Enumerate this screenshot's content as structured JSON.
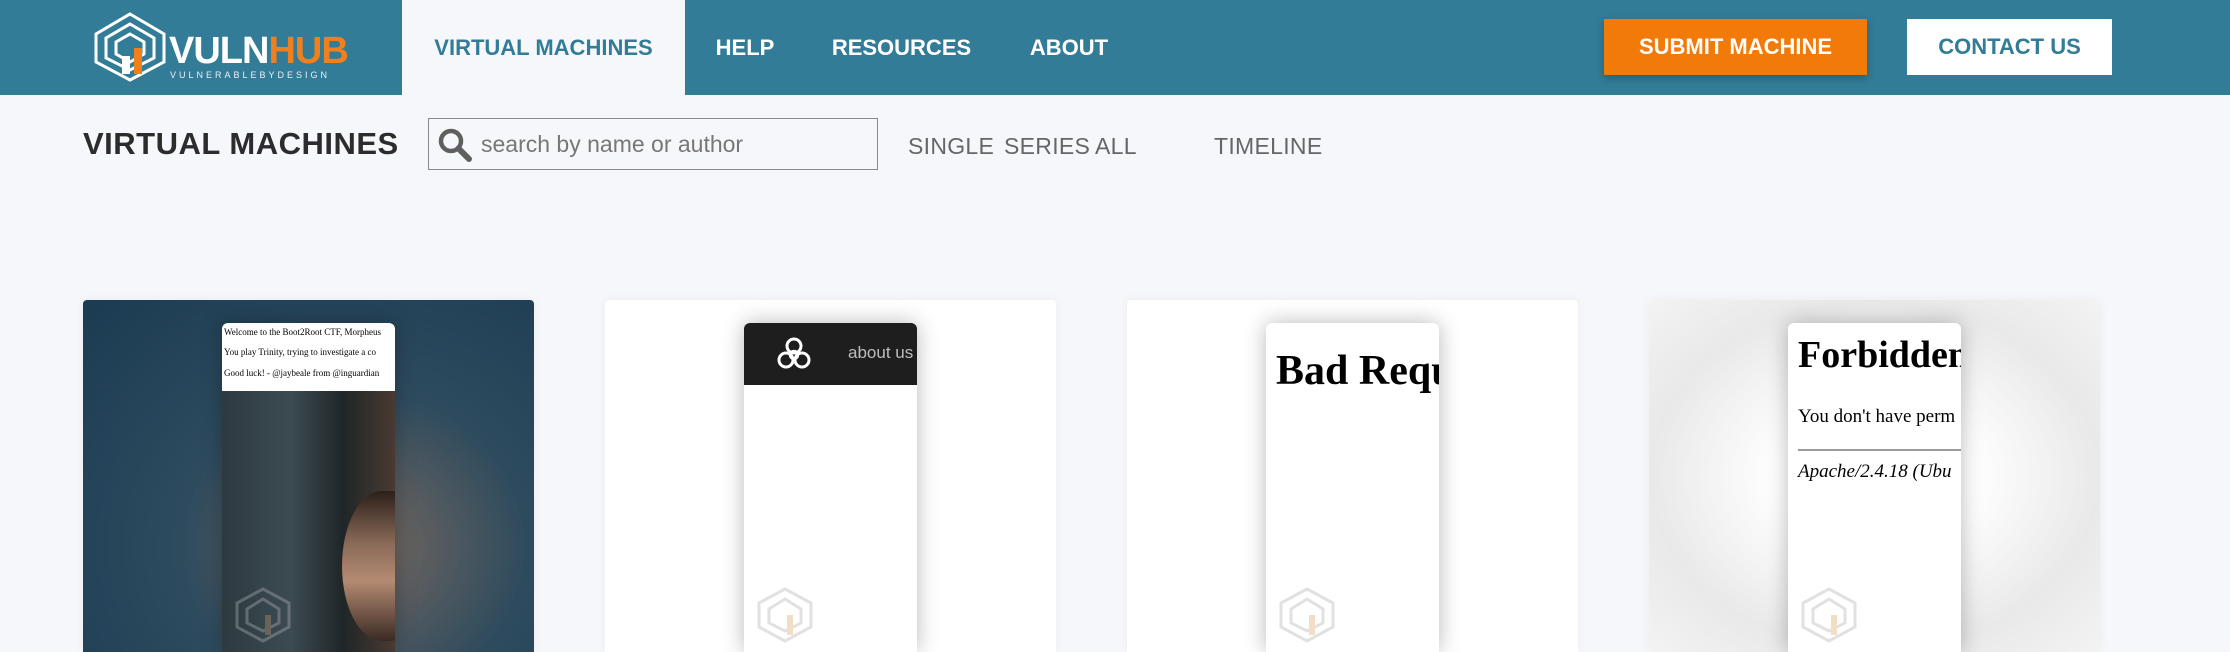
{
  "brand": {
    "name_part1": "VULN",
    "name_part2": "HUB",
    "tagline": "VULNERABLEBYDESIGN",
    "accent": "#f0801e",
    "primary": "#327c97"
  },
  "nav": {
    "items": [
      {
        "label": "VIRTUAL MACHINES",
        "active": true
      },
      {
        "label": "HELP",
        "active": false
      },
      {
        "label": "RESOURCES",
        "active": false
      },
      {
        "label": "ABOUT",
        "active": false
      }
    ],
    "submit_label": "SUBMIT MACHINE",
    "contact_label": "CONTACT US"
  },
  "toolbar": {
    "title": "VIRTUAL MACHINES",
    "search_placeholder": "search by name or author",
    "filters": [
      "SINGLE",
      "SERIES",
      "ALL",
      "TIMELINE"
    ]
  },
  "cards": [
    {
      "preview_lines": [
        "Welcome to the Boot2Root CTF, Morpheus",
        "You play Trinity, trying to investigate a co",
        "Good luck! - @jaybeale from @inguardian"
      ]
    },
    {
      "nav_text": "about us",
      "icon": "biohazard-icon"
    },
    {
      "heading": "Bad Requ"
    },
    {
      "heading": "Forbidden",
      "message": "You don't have perm",
      "server": "Apache/2.4.18 (Ubu"
    }
  ]
}
